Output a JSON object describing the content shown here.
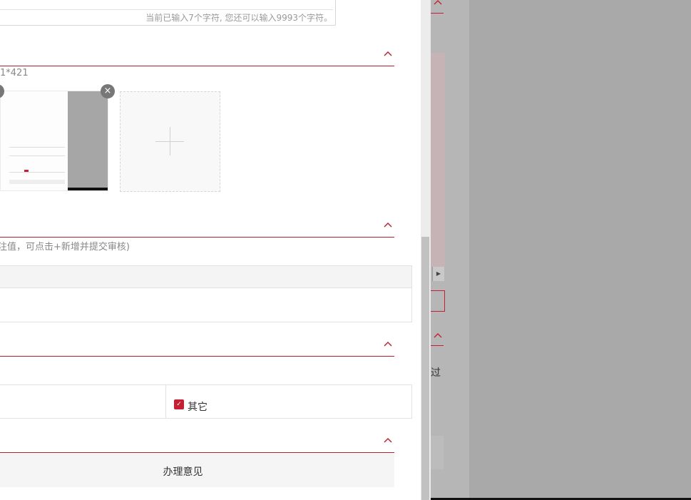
{
  "form": {
    "char_counter": "当前已输入7个字符, 您还可以输入9993个字符。",
    "image_hint": "1*421",
    "remove_icon": "×",
    "table_hint": "注值，可点击+新增并提交审核)",
    "checkbox_label": "其它",
    "checkbox_mark": "✓",
    "opinion_label": "办理意见"
  },
  "background": {
    "partial_text": "过",
    "scroll_arrow": "▶"
  },
  "colors": {
    "accent": "#b51d2b",
    "checkbox": "#c32033"
  }
}
